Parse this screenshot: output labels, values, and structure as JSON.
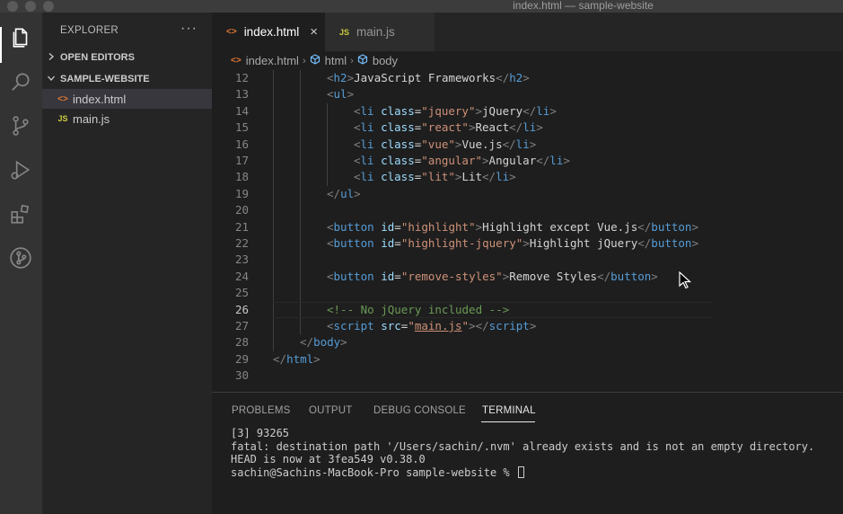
{
  "window": {
    "title": "index.html — sample-website"
  },
  "activity_bar": {
    "icons": [
      "explorer-icon",
      "search-icon",
      "source-control-icon",
      "run-debug-icon",
      "extensions-icon",
      "git-graph-icon"
    ]
  },
  "sidebar": {
    "header": "EXPLORER",
    "more_actions": "···",
    "open_editors": "OPEN EDITORS",
    "project": "SAMPLE-WEBSITE",
    "files": [
      {
        "icon": "<>",
        "label": "index.html"
      },
      {
        "icon": "JS",
        "label": "main.js"
      }
    ]
  },
  "tabs": [
    {
      "icon": "<>",
      "label": "index.html",
      "close": "×"
    },
    {
      "icon": "JS",
      "label": "main.js"
    }
  ],
  "breadcrumb": {
    "file": "index.html",
    "items": [
      "html",
      "body"
    ]
  },
  "editor": {
    "line_numbers": [
      "12",
      "13",
      "14",
      "15",
      "16",
      "17",
      "18",
      "19",
      "20",
      "21",
      "22",
      "23",
      "24",
      "25",
      "26",
      "27",
      "28",
      "29",
      "30"
    ],
    "lines": [
      [
        {
          "c": "t-br",
          "t": "<"
        },
        {
          "c": "t-tag",
          "t": "h2"
        },
        {
          "c": "t-br",
          "t": ">"
        },
        {
          "c": "t-txt",
          "t": "JavaScript Frameworks"
        },
        {
          "c": "t-br",
          "t": "</"
        },
        {
          "c": "t-tag",
          "t": "h2"
        },
        {
          "c": "t-br",
          "t": ">"
        }
      ],
      [
        {
          "c": "t-br",
          "t": "<"
        },
        {
          "c": "t-tag",
          "t": "ul"
        },
        {
          "c": "t-br",
          "t": ">"
        }
      ],
      [
        {
          "c": "t-br",
          "t": "<"
        },
        {
          "c": "t-tag",
          "t": "li "
        },
        {
          "c": "t-attr",
          "t": "class"
        },
        {
          "c": "t-txt",
          "t": "="
        },
        {
          "c": "t-str",
          "t": "\"jquery\""
        },
        {
          "c": "t-br",
          "t": ">"
        },
        {
          "c": "t-txt",
          "t": "jQuery"
        },
        {
          "c": "t-br",
          "t": "</"
        },
        {
          "c": "t-tag",
          "t": "li"
        },
        {
          "c": "t-br",
          "t": ">"
        }
      ],
      [
        {
          "c": "t-br",
          "t": "<"
        },
        {
          "c": "t-tag",
          "t": "li "
        },
        {
          "c": "t-attr",
          "t": "class"
        },
        {
          "c": "t-txt",
          "t": "="
        },
        {
          "c": "t-str",
          "t": "\"react\""
        },
        {
          "c": "t-br",
          "t": ">"
        },
        {
          "c": "t-txt",
          "t": "React"
        },
        {
          "c": "t-br",
          "t": "</"
        },
        {
          "c": "t-tag",
          "t": "li"
        },
        {
          "c": "t-br",
          "t": ">"
        }
      ],
      [
        {
          "c": "t-br",
          "t": "<"
        },
        {
          "c": "t-tag",
          "t": "li "
        },
        {
          "c": "t-attr",
          "t": "class"
        },
        {
          "c": "t-txt",
          "t": "="
        },
        {
          "c": "t-str",
          "t": "\"vue\""
        },
        {
          "c": "t-br",
          "t": ">"
        },
        {
          "c": "t-txt",
          "t": "Vue.js"
        },
        {
          "c": "t-br",
          "t": "</"
        },
        {
          "c": "t-tag",
          "t": "li"
        },
        {
          "c": "t-br",
          "t": ">"
        }
      ],
      [
        {
          "c": "t-br",
          "t": "<"
        },
        {
          "c": "t-tag",
          "t": "li "
        },
        {
          "c": "t-attr",
          "t": "class"
        },
        {
          "c": "t-txt",
          "t": "="
        },
        {
          "c": "t-str",
          "t": "\"angular\""
        },
        {
          "c": "t-br",
          "t": ">"
        },
        {
          "c": "t-txt",
          "t": "Angular"
        },
        {
          "c": "t-br",
          "t": "</"
        },
        {
          "c": "t-tag",
          "t": "li"
        },
        {
          "c": "t-br",
          "t": ">"
        }
      ],
      [
        {
          "c": "t-br",
          "t": "<"
        },
        {
          "c": "t-tag",
          "t": "li "
        },
        {
          "c": "t-attr",
          "t": "class"
        },
        {
          "c": "t-txt",
          "t": "="
        },
        {
          "c": "t-str",
          "t": "\"lit\""
        },
        {
          "c": "t-br",
          "t": ">"
        },
        {
          "c": "t-txt",
          "t": "Lit"
        },
        {
          "c": "t-br",
          "t": "</"
        },
        {
          "c": "t-tag",
          "t": "li"
        },
        {
          "c": "t-br",
          "t": ">"
        }
      ],
      [
        {
          "c": "t-br",
          "t": "</"
        },
        {
          "c": "t-tag",
          "t": "ul"
        },
        {
          "c": "t-br",
          "t": ">"
        }
      ],
      [],
      [
        {
          "c": "t-br",
          "t": "<"
        },
        {
          "c": "t-tag",
          "t": "button "
        },
        {
          "c": "t-attr",
          "t": "id"
        },
        {
          "c": "t-txt",
          "t": "="
        },
        {
          "c": "t-str",
          "t": "\"highlight\""
        },
        {
          "c": "t-br",
          "t": ">"
        },
        {
          "c": "t-txt",
          "t": "Highlight except Vue.js"
        },
        {
          "c": "t-br",
          "t": "</"
        },
        {
          "c": "t-tag",
          "t": "button"
        },
        {
          "c": "t-br",
          "t": ">"
        }
      ],
      [
        {
          "c": "t-br",
          "t": "<"
        },
        {
          "c": "t-tag",
          "t": "button "
        },
        {
          "c": "t-attr",
          "t": "id"
        },
        {
          "c": "t-txt",
          "t": "="
        },
        {
          "c": "t-str",
          "t": "\"highlight-jquery\""
        },
        {
          "c": "t-br",
          "t": ">"
        },
        {
          "c": "t-txt",
          "t": "Highlight jQuery"
        },
        {
          "c": "t-br",
          "t": "</"
        },
        {
          "c": "t-tag",
          "t": "button"
        },
        {
          "c": "t-br",
          "t": ">"
        }
      ],
      [],
      [
        {
          "c": "t-br",
          "t": "<"
        },
        {
          "c": "t-tag",
          "t": "button "
        },
        {
          "c": "t-attr",
          "t": "id"
        },
        {
          "c": "t-txt",
          "t": "="
        },
        {
          "c": "t-str",
          "t": "\"remove-styles\""
        },
        {
          "c": "t-br",
          "t": ">"
        },
        {
          "c": "t-txt",
          "t": "Remove Styles"
        },
        {
          "c": "t-br",
          "t": "</"
        },
        {
          "c": "t-tag",
          "t": "button"
        },
        {
          "c": "t-br",
          "t": ">"
        }
      ],
      [],
      [
        {
          "c": "t-com",
          "t": "<!-- No jQuery included -->"
        }
      ],
      [
        {
          "c": "t-br",
          "t": "<"
        },
        {
          "c": "t-tag",
          "t": "script "
        },
        {
          "c": "t-attr",
          "t": "src"
        },
        {
          "c": "t-txt",
          "t": "="
        },
        {
          "c": "t-str",
          "t": "\""
        },
        {
          "c": "t-link",
          "t": "main.js"
        },
        {
          "c": "t-str",
          "t": "\""
        },
        {
          "c": "t-br",
          "t": "></"
        },
        {
          "c": "t-tag",
          "t": "script"
        },
        {
          "c": "t-br",
          "t": ">"
        }
      ],
      [
        {
          "c": "t-br",
          "t": "</"
        },
        {
          "c": "t-tag",
          "t": "body"
        },
        {
          "c": "t-br",
          "t": ">"
        }
      ],
      [
        {
          "c": "t-br",
          "t": "</"
        },
        {
          "c": "t-tag",
          "t": "html"
        },
        {
          "c": "t-br",
          "t": ">"
        }
      ],
      []
    ]
  },
  "panel": {
    "tabs": [
      "PROBLEMS",
      "OUTPUT",
      "DEBUG CONSOLE",
      "TERMINAL"
    ],
    "active_tab": "TERMINAL",
    "terminal_lines": [
      "[3] 93265",
      "fatal: destination path '/Users/sachin/.nvm' already exists and is not an empty directory.",
      "HEAD is now at 3fea549 v0.38.0",
      "sachin@Sachins-MacBook-Pro sample-website % "
    ]
  }
}
